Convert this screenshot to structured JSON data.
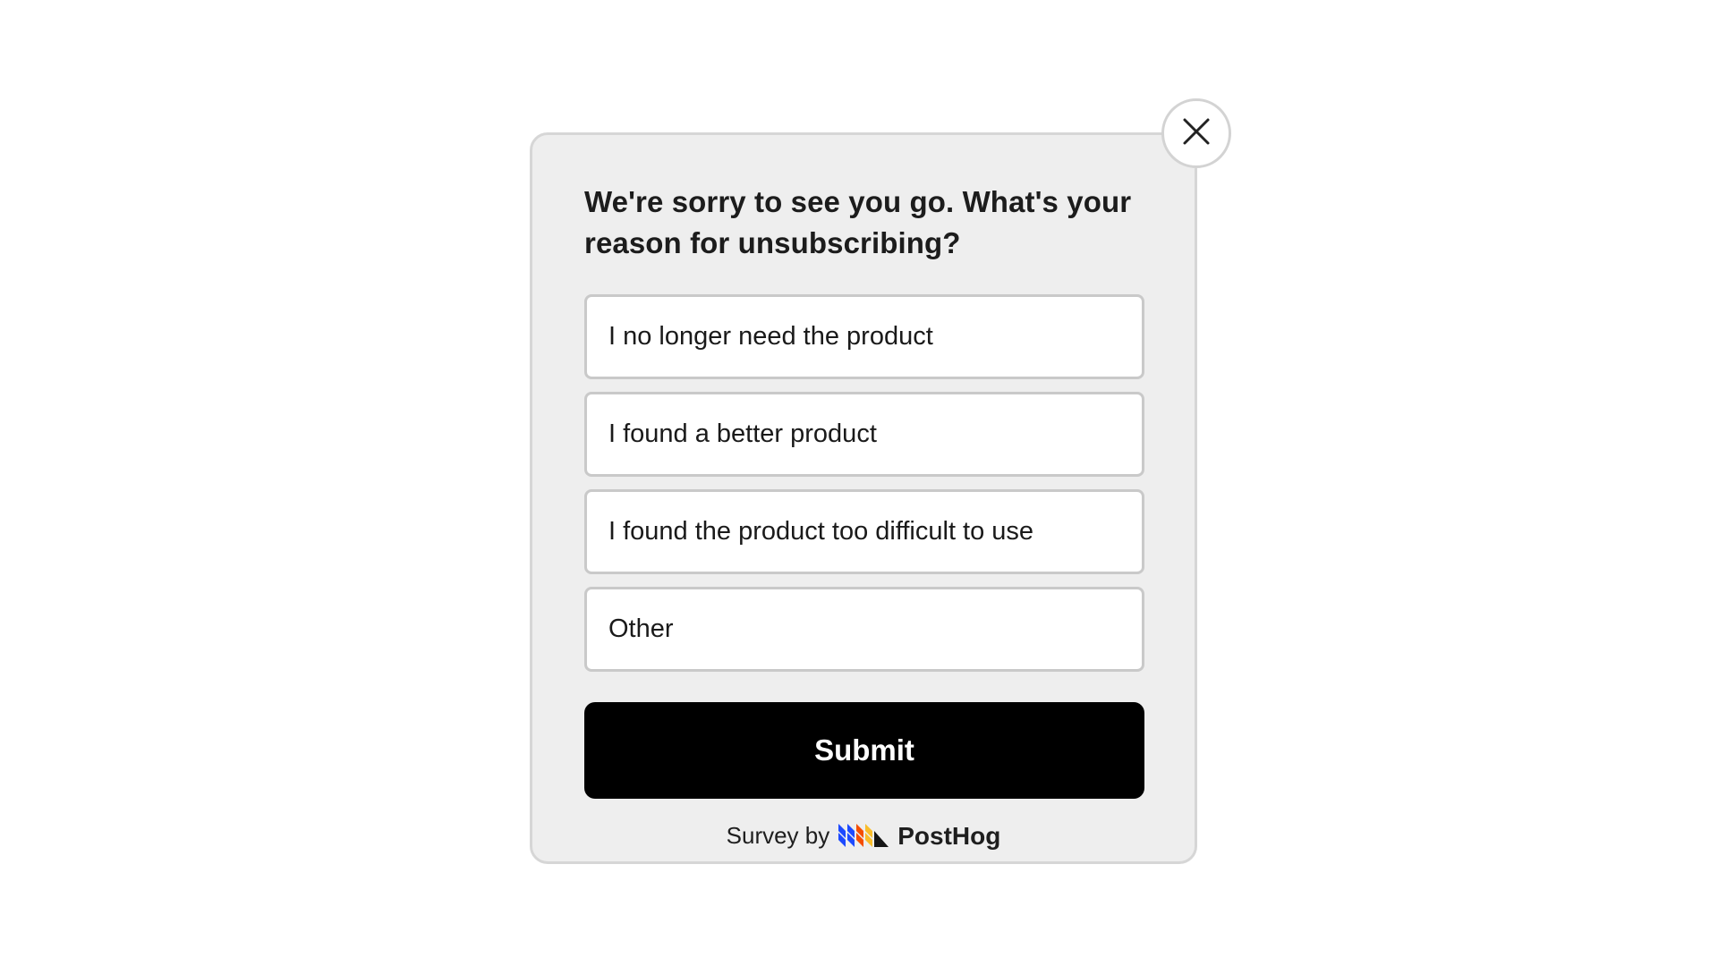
{
  "survey": {
    "question": "We're sorry to see you go. What's your reason for unsubscribing?",
    "choices": [
      "I no longer need the product",
      "I found a better product",
      "I found the product too difficult to use",
      "Other"
    ],
    "submit_label": "Submit",
    "footer_prefix": "Survey by",
    "brand_name": "PostHog"
  },
  "icons": {
    "close": "close-icon",
    "brand": "posthog-logo-icon"
  },
  "colors": {
    "card_bg": "#eeeeee",
    "submit_bg": "#000000",
    "submit_text": "#ffffff",
    "logo_blue": "#1d4aff",
    "logo_orange": "#f54e00",
    "logo_yellow": "#f9bd2b"
  }
}
